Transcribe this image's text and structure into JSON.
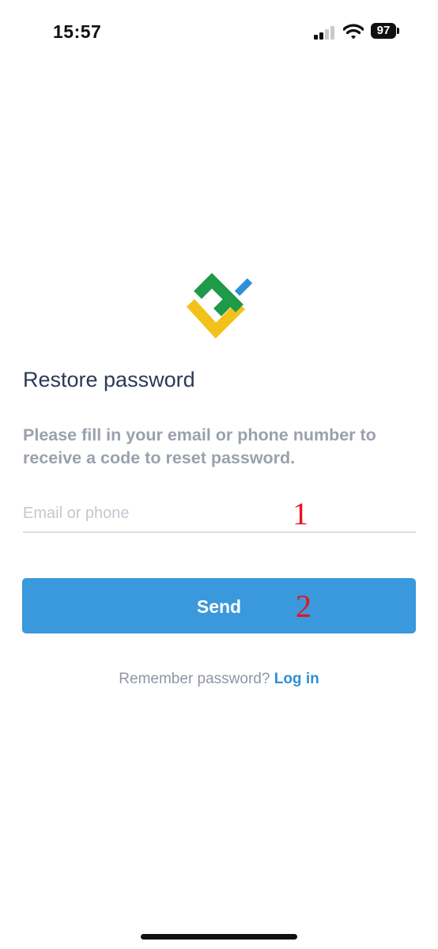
{
  "status_bar": {
    "time": "15:57",
    "battery": "97",
    "signal_bars_active": 2,
    "signal_bars_total": 4,
    "icons": [
      "signal-icon",
      "wifi-icon",
      "battery-icon"
    ]
  },
  "logo": {
    "name": "app-logo",
    "colors": [
      "#1e9a48",
      "#f2c21b",
      "#2f8fd6"
    ]
  },
  "page": {
    "title": "Restore password",
    "instructions": "Please fill in your email or phone number to receive a code to reset password."
  },
  "form": {
    "email_placeholder": "Email or phone",
    "email_value": "",
    "send_label": "Send"
  },
  "annotations": {
    "one": "1",
    "two": "2"
  },
  "footer": {
    "remember_text": "Remember password?",
    "login_link": "Log in"
  },
  "colors": {
    "accent": "#3a98dc",
    "link": "#2f8fd6",
    "title": "#2b3a55",
    "muted": "#9aa1ad",
    "annotation": "#e8131c"
  }
}
